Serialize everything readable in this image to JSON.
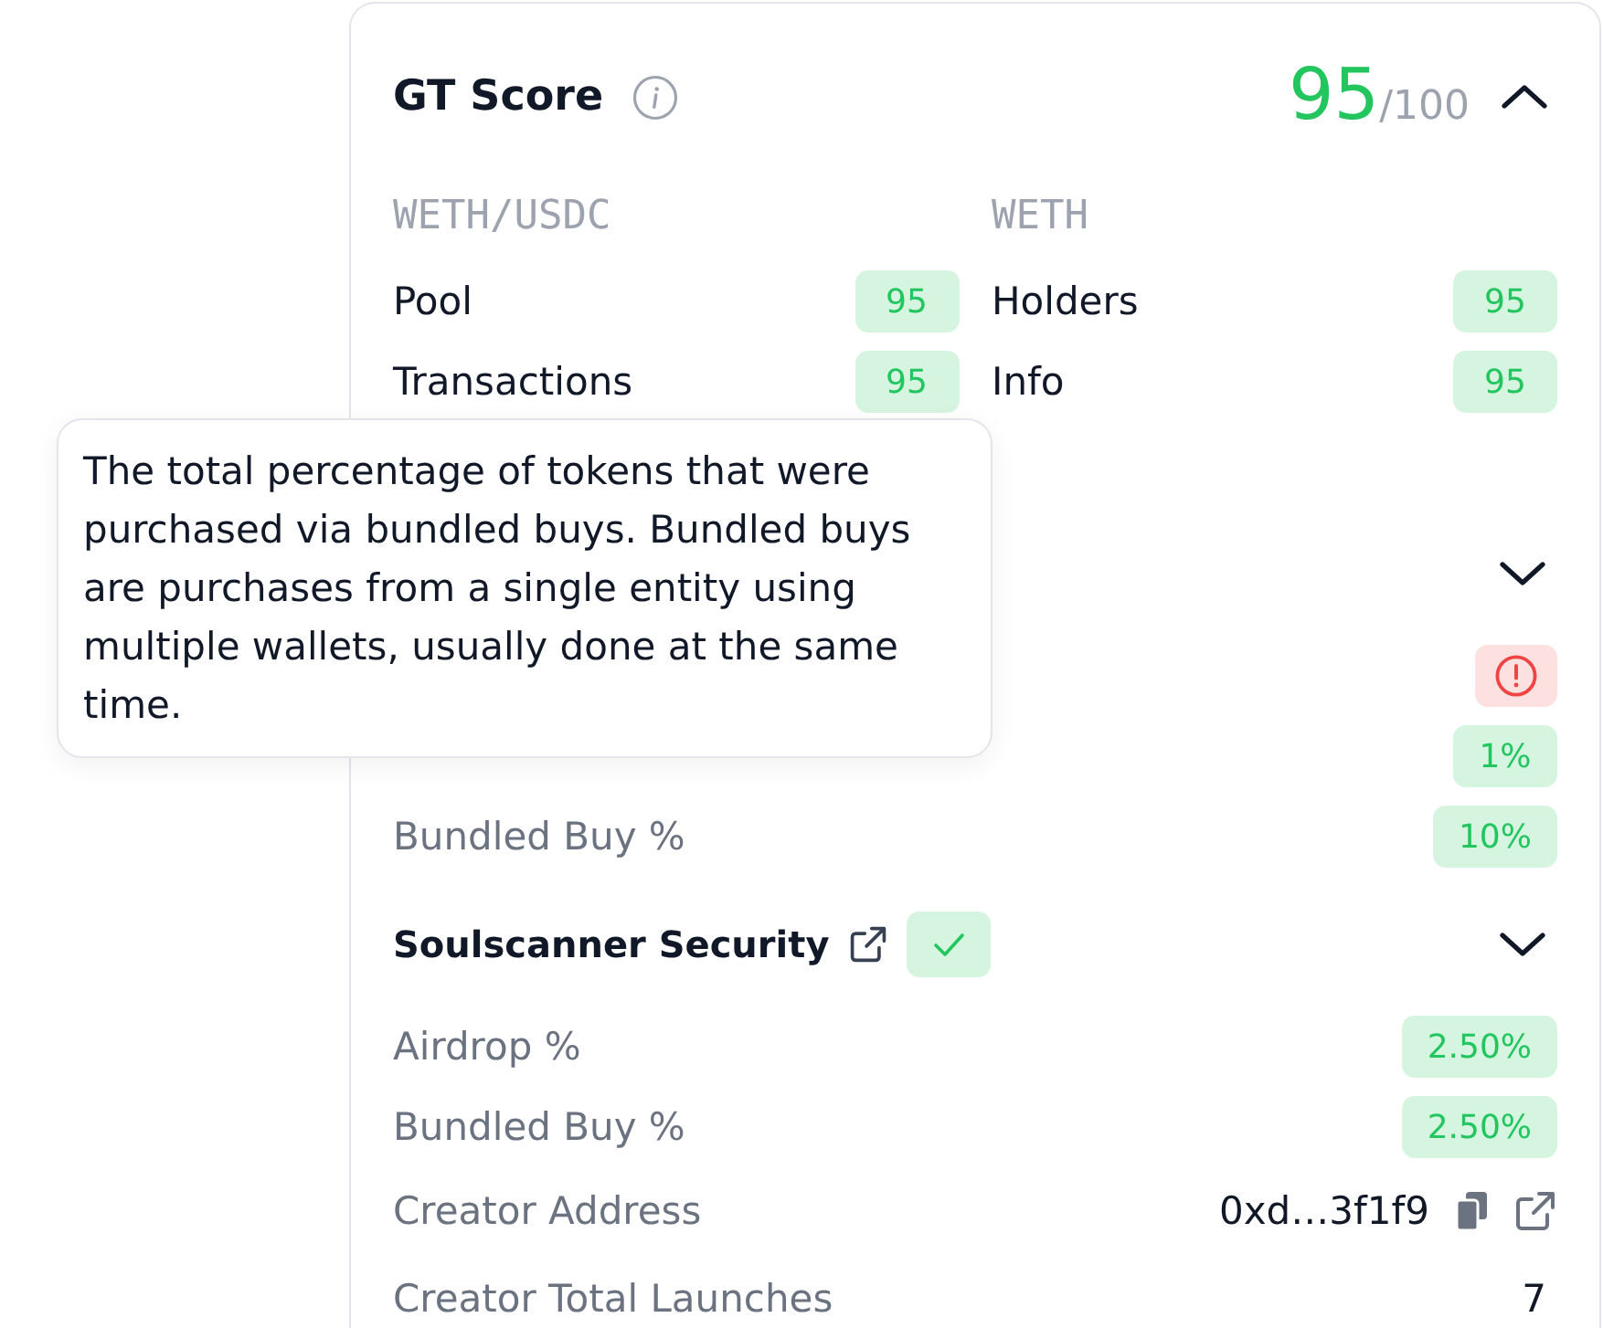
{
  "score_card": {
    "title": "GT Score",
    "score": "95",
    "score_max": "/100",
    "expanded": true,
    "pairs": [
      {
        "heading": "WETH/USDC",
        "rows": [
          {
            "label": "Pool",
            "value": "95"
          },
          {
            "label": "Transactions",
            "value": "95"
          }
        ]
      },
      {
        "heading": "WETH",
        "rows": [
          {
            "label": "Holders",
            "value": "95"
          },
          {
            "label": "Info",
            "value": "95"
          }
        ]
      }
    ]
  },
  "sections": [
    {
      "expanded": false,
      "rows": [
        {
          "kind": "alert"
        },
        {
          "kind": "badge",
          "value": "1%"
        },
        {
          "kind": "badge",
          "label": "Bundled Buy %",
          "value": "10%"
        }
      ]
    },
    {
      "title": "Soulscanner Security",
      "expanded": false,
      "link": true,
      "verified": true,
      "rows": [
        {
          "kind": "badge",
          "label": "Airdrop %",
          "value": "2.50%"
        },
        {
          "kind": "badge",
          "label": "Bundled Buy %",
          "value": "2.50%"
        },
        {
          "kind": "address",
          "label": "Creator Address",
          "value": "0xd…3f1f9"
        },
        {
          "kind": "text",
          "label": "Creator Total Launches",
          "value": "7"
        }
      ]
    }
  ],
  "tooltip": {
    "text": "The total percentage of tokens that were purchased via bundled buys. Bundled buys are purchases from a single entity using multiple wallets, usually done at the same time."
  }
}
